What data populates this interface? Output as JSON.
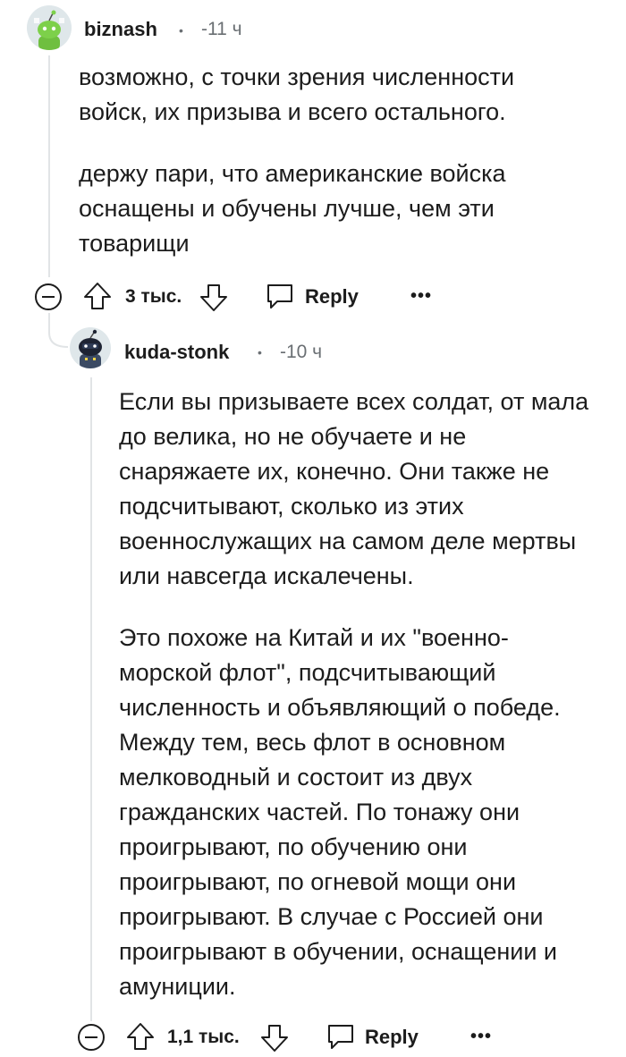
{
  "comment1": {
    "username": "biznash",
    "time": "-11 ч",
    "paragraphs": [
      "возможно, с точки зрения численности войск, их призыва и всего остального.",
      "держу пари, что американские войска оснащены и обучены лучше, чем эти товарищи"
    ],
    "vote_count": "3 тыс.",
    "reply_label": "Reply",
    "more_label": "•••"
  },
  "comment2": {
    "username": "kuda-stonk",
    "time": "-10 ч",
    "paragraphs": [
      "Если вы призываете всех солдат, от мала до велика, но не обучаете и не снаряжаете их, конечно. Они также не подсчитывают, сколько из этих военнослужащих на самом деле мертвы или навсегда искалечены.",
      "Это похоже на Китай и их \"военно-морской флот\", подсчитывающий численность и объявляющий о победе. Между тем, весь флот в основном мелководный и состоит из двух гражданских частей. По тонажу они проигрывают, по обучению они проигрывают, по огневой мощи они проигрывают. В случае с Россией они проигрывают в обучении, оснащении и амуниции."
    ],
    "vote_count": "1,1 тыс.",
    "reply_label": "Reply",
    "more_label": "•••"
  },
  "separator_dot": "•",
  "icons": [
    "avatar-snoo",
    "collapse-icon",
    "upvote-icon",
    "downvote-icon",
    "reply-icon",
    "more-icon"
  ]
}
